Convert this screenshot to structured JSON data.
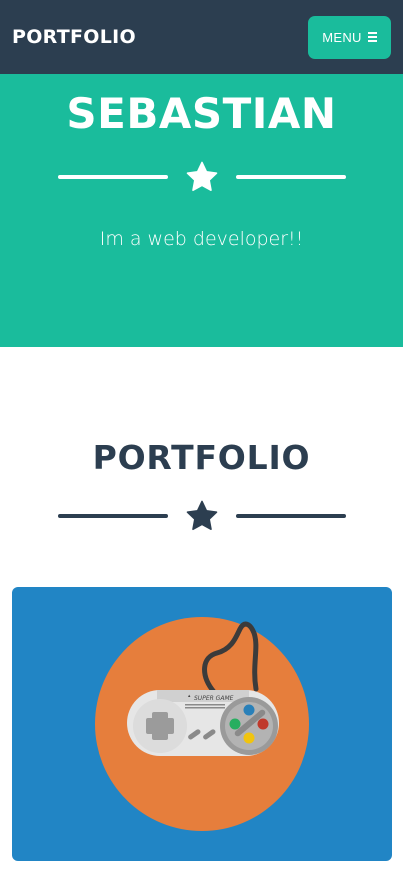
{
  "navbar": {
    "brand": "PORTFOLIO",
    "menu_label": "MENU",
    "menu_icon": "hamburger-icon"
  },
  "masthead": {
    "name": "SEBASTIAN",
    "divider_icon": "star-icon",
    "subtitle": "Im a web developer!!"
  },
  "portfolio": {
    "title": "PORTFOLIO",
    "divider_icon": "star-icon",
    "items": [
      {
        "image": "game-controller-illustration",
        "controller_label": "SUPER GAME"
      }
    ]
  },
  "colors": {
    "nav_bg": "#2c3e50",
    "accent": "#1abc9c",
    "card_bg": "#2185c5",
    "circle": "#e67e3c"
  }
}
